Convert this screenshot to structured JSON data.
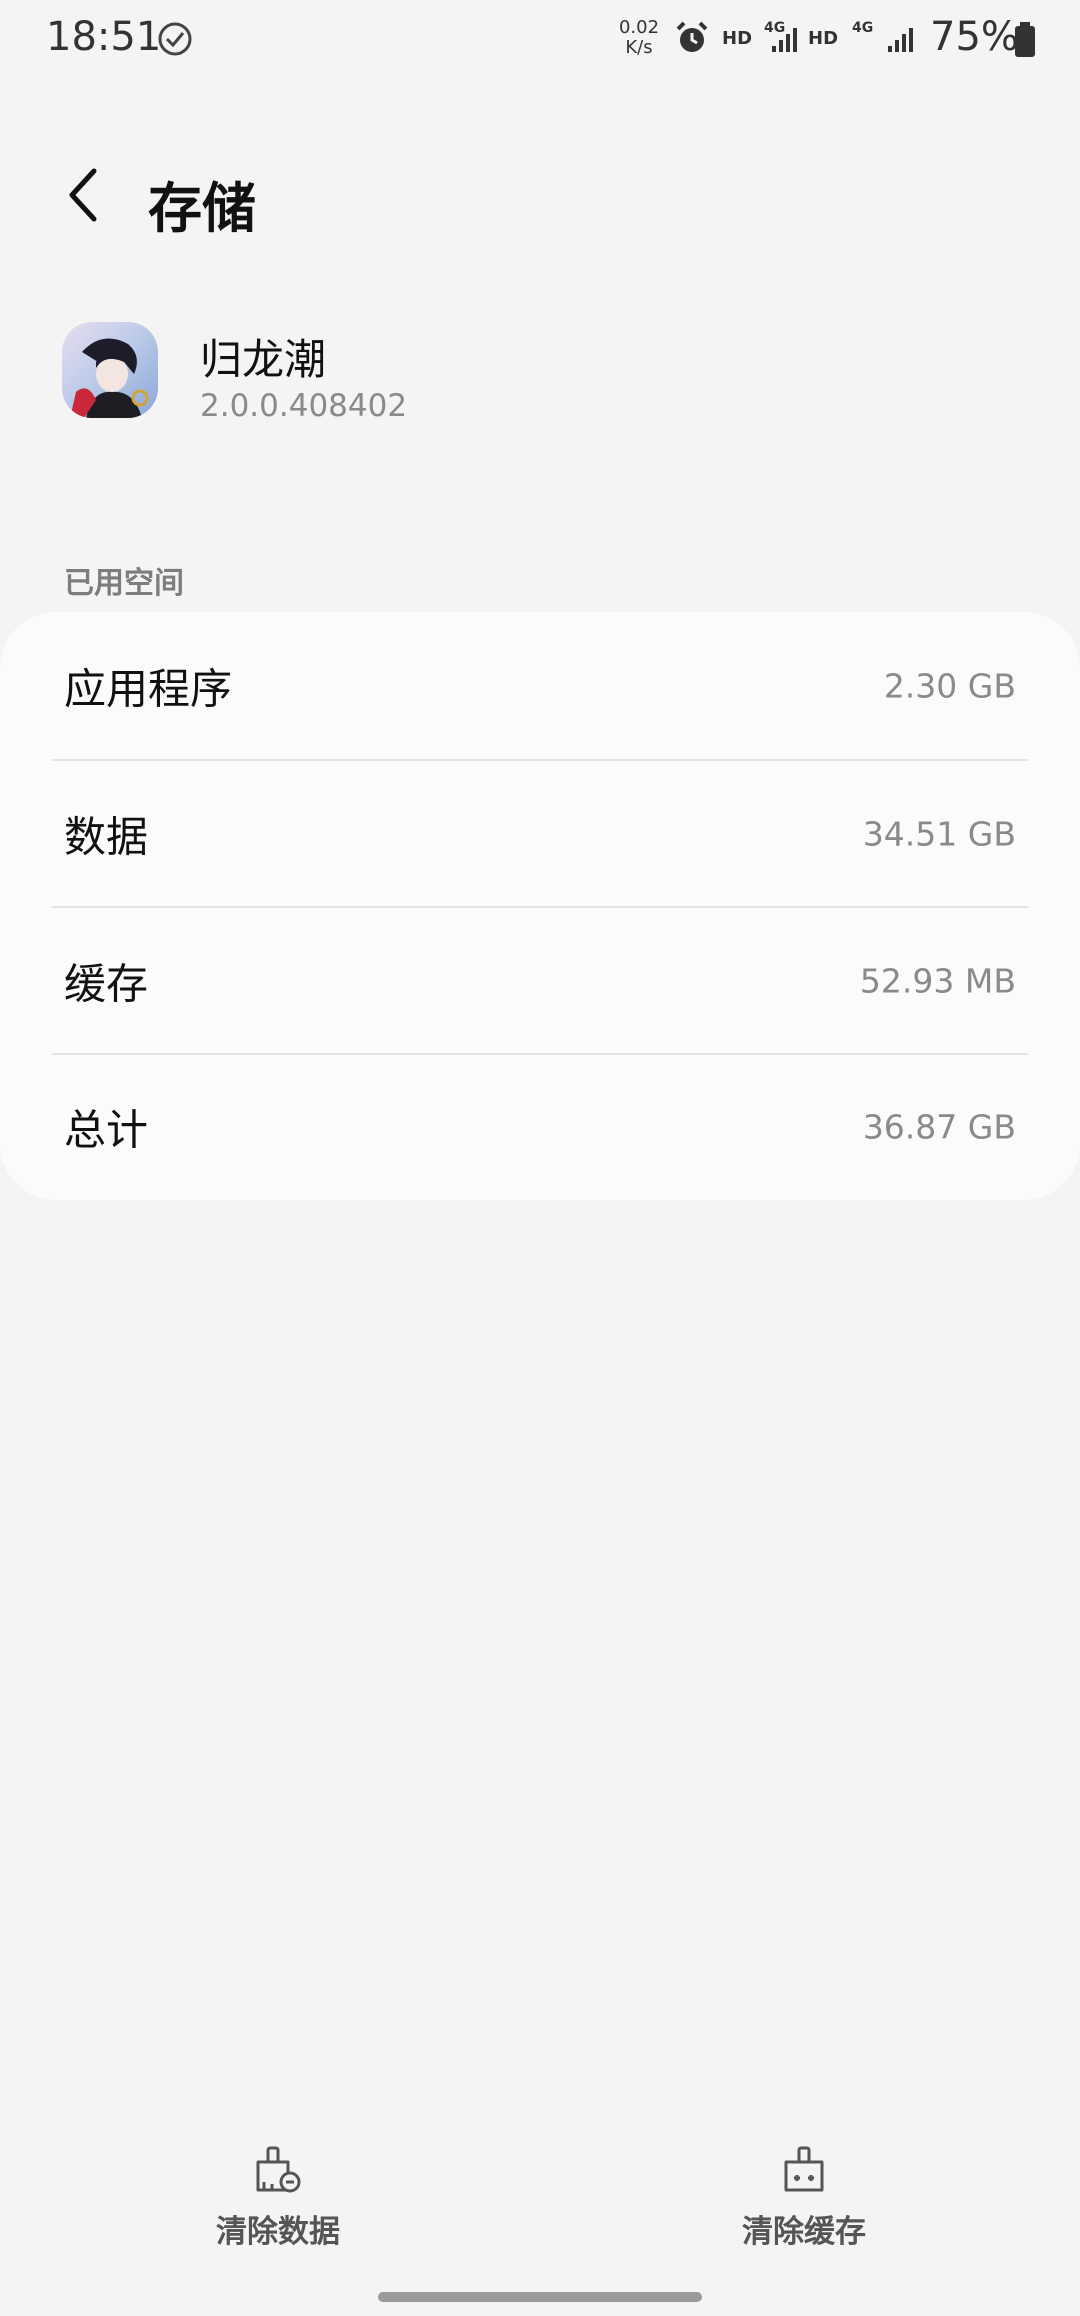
{
  "status_bar": {
    "time": "18:51",
    "speed_value": "0.02",
    "speed_unit": "K/s",
    "hd_1": "HD",
    "net_1": "4G",
    "hd_2": "HD",
    "net_2": "4G",
    "battery": "75%"
  },
  "header": {
    "title": "存储",
    "back_icon": "chevron-left-icon"
  },
  "app": {
    "name": "归龙潮",
    "version": "2.0.0.408402"
  },
  "storage": {
    "section_label": "已用空间",
    "rows": [
      {
        "label": "应用程序",
        "value": "2.30 GB"
      },
      {
        "label": "数据",
        "value": "34.51 GB"
      },
      {
        "label": "缓存",
        "value": "52.93 MB"
      },
      {
        "label": "总计",
        "value": "36.87 GB"
      }
    ]
  },
  "actions": {
    "clear_data": {
      "label": "清除数据",
      "icon": "clear-data-icon"
    },
    "clear_cache": {
      "label": "清除缓存",
      "icon": "clear-cache-icon"
    }
  }
}
